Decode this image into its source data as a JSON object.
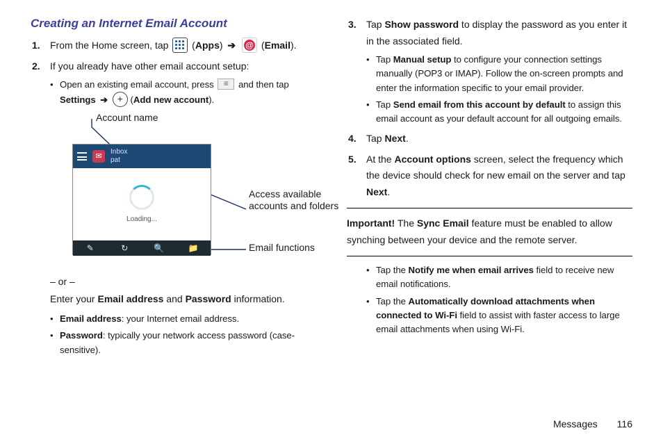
{
  "title": "Creating an Internet Email Account",
  "step1": {
    "pre": "From the Home screen, tap ",
    "apps": "Apps",
    "email": "Email"
  },
  "step2": {
    "text": "If you already have other email account setup:",
    "b1_a": "Open an existing email account, press ",
    "b1_b": " and then tap ",
    "settings": "Settings",
    "addnew": "Add new account"
  },
  "illus": {
    "account_name": "Account name",
    "access": "Access available accounts and folders",
    "email_functions": "Email functions",
    "inbox": "Inbox",
    "pat": "pat",
    "loading": "Loading..."
  },
  "or": "– or –",
  "enter_line": {
    "pre": "Enter your ",
    "ea": "Email address",
    "and": " and ",
    "pw": "Password",
    "post": " information."
  },
  "bul_a": {
    "label": "Email address",
    "text": ": your Internet email address."
  },
  "bul_b": {
    "label": "Password",
    "text": ": typically your network access password (case-sensitive)."
  },
  "step3": {
    "pre": "Tap ",
    "sp": "Show password",
    "post": " to display the password as you enter it in the associated field.",
    "b1": {
      "pre": "Tap ",
      "ms": "Manual setup",
      "post": " to configure your connection settings manually (POP3 or IMAP). Follow the on-screen prompts and enter the information specific to your email provider."
    },
    "b2": {
      "pre": "Tap ",
      "sd": "Send email from this account by default",
      "post": " to assign this email account as your default account for all outgoing emails."
    }
  },
  "step4": {
    "pre": "Tap ",
    "next": "Next",
    "post": "."
  },
  "step5": {
    "pre": "At the ",
    "ao": "Account options",
    "mid": " screen, select the frequency which the device should check for new email on the server and tap ",
    "next": "Next",
    "post": "."
  },
  "important": {
    "label": "Important!",
    "pre": " The ",
    "se": "Sync Email",
    "post": " feature must be enabled to allow synching between your device and the remote server."
  },
  "tail": {
    "b1": {
      "pre": "Tap the ",
      "nf": "Notify me when email arrives",
      "post": " field to receive new email notifications."
    },
    "b2": {
      "pre": "Tap the ",
      "ad": "Automatically download attachments when connected to Wi-Fi",
      "post": " field to assist with faster access to large email attachments when using Wi-Fi."
    }
  },
  "footer": {
    "section": "Messages",
    "page": "116"
  }
}
